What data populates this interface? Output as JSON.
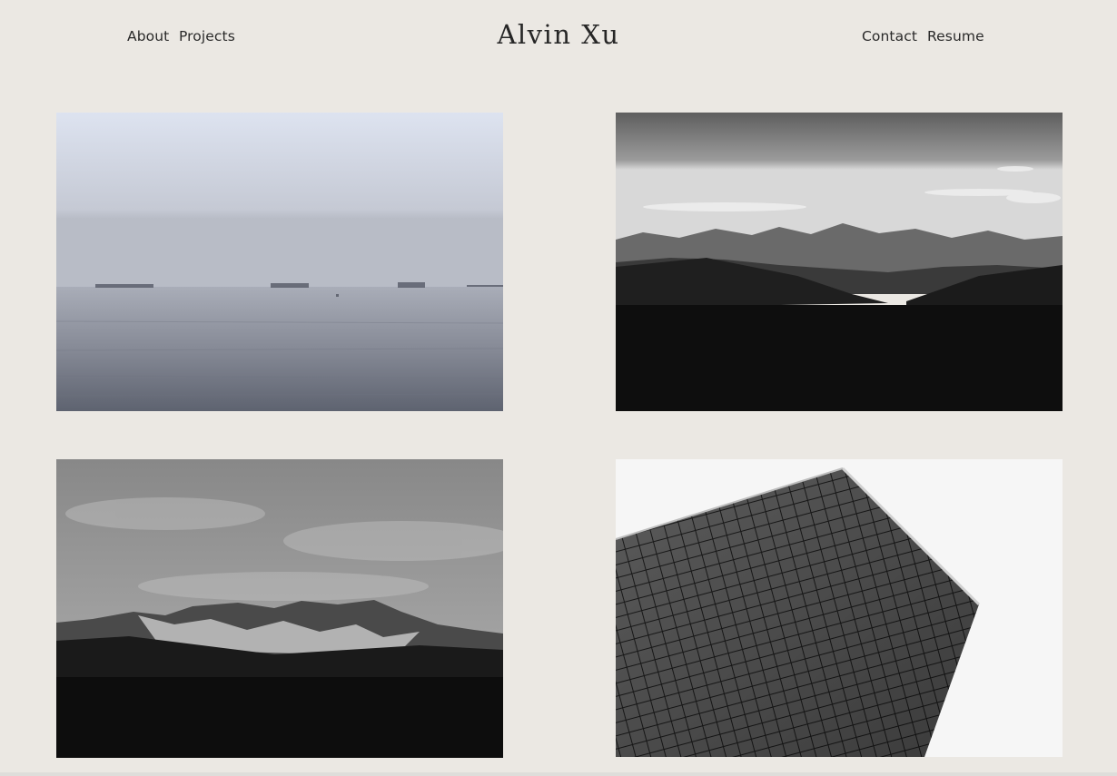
{
  "header": {
    "title": "Alvin Xu",
    "left_links": [
      "About",
      "Projects"
    ],
    "right_links": [
      "Contact",
      "Resume"
    ]
  },
  "colors": {
    "background": "#ebe8e3",
    "text": "#262626"
  },
  "gallery": {
    "tiles": [
      {
        "subject": "foggy sea with ships on horizon",
        "tone": "muted blue-grey"
      },
      {
        "subject": "mountain range silhouette at dusk",
        "tone": "black and white"
      },
      {
        "subject": "rocky mountain ridge under cloudy sky",
        "tone": "black and white"
      },
      {
        "subject": "glass skyscraper looking up",
        "tone": "black and white"
      }
    ]
  }
}
